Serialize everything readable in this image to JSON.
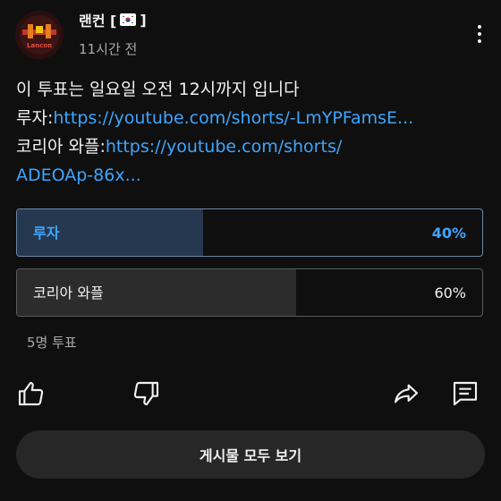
{
  "post": {
    "channel_name": "랜컨 [",
    "channel_name_end": "]",
    "avatar_text": "Lancon",
    "time_ago": "11시간 전",
    "text_line1": "이 투표는 일요일 오전 12시까지 입니다",
    "line2_prefix": "루자:",
    "line2_link": "https://youtube.com/shorts/-LmYPFamsE...",
    "line3_prefix": "코리아 와플:",
    "line3_link": "https://youtube.com/shorts/",
    "line4_link": "ADEOAp-86x..."
  },
  "poll": {
    "options": [
      {
        "label": "루자",
        "percent_text": "40%",
        "percent": 40,
        "selected": true
      },
      {
        "label": "코리아 와플",
        "percent_text": "60%",
        "percent": 60,
        "selected": false
      }
    ],
    "votes": "5명 투표"
  },
  "actions": {
    "view_all_label": "게시물 모두 보기"
  },
  "colors": {
    "background": "#0f0f0f",
    "link": "#3ea6ff",
    "selected_fill": "#263850",
    "button": "#272727"
  },
  "icons": [
    "like-icon",
    "dislike-icon",
    "share-icon",
    "comment-icon",
    "more-vertical-icon",
    "korea-flag-icon"
  ]
}
